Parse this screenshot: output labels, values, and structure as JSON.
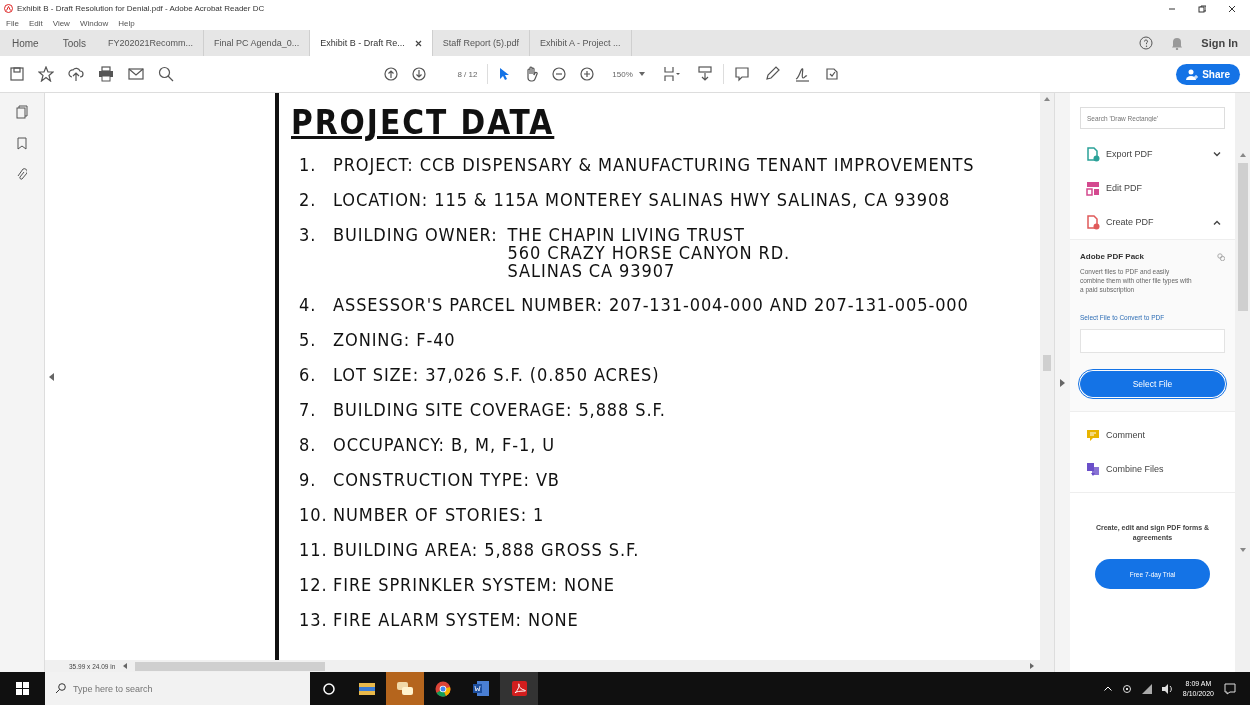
{
  "window": {
    "title": "Exhibit B - Draft Resolution for Denial.pdf - Adobe Acrobat Reader DC"
  },
  "menu": [
    "File",
    "Edit",
    "View",
    "Window",
    "Help"
  ],
  "tabs": [
    {
      "label": "Home",
      "selected": false,
      "closable": false
    },
    {
      "label": "Tools",
      "selected": false,
      "closable": false
    },
    {
      "label": "FY202021Recomm...",
      "selected": false,
      "closable": false
    },
    {
      "label": "Final PC Agenda_0...",
      "selected": false,
      "closable": false
    },
    {
      "label": "Exhibit B - Draft Re...",
      "selected": true,
      "closable": true
    },
    {
      "label": "Staff Report (5).pdf",
      "selected": false,
      "closable": false
    },
    {
      "label": "Exhibit A - Project ...",
      "selected": false,
      "closable": false
    }
  ],
  "account": {
    "sign_in": "Sign In"
  },
  "toolbar": {
    "page_number": "8",
    "page_count": "/ 12",
    "zoom": "150%",
    "share": "Share"
  },
  "document": {
    "heading": "PROJECT DATA",
    "items": [
      {
        "number": "1.",
        "text": "PROJECT:  CCB DISPENSARY & MANUFACTURING TENANT IMPROVEMENTS"
      },
      {
        "number": "2.",
        "text": "LOCATION: 115 & 115A MONTEREY SALINAS HWY SALINAS, CA 93908"
      },
      {
        "number": "3.",
        "label": "BUILDING OWNER:",
        "lines": [
          "THE CHAPIN LIVING TRUST",
          "560 CRAZY HORSE CANYON RD.",
          "SALINAS CA 93907"
        ]
      },
      {
        "number": "4.",
        "text": "ASSESSOR'S PARCEL NUMBER: 207-131-004-000 AND 207-131-005-000"
      },
      {
        "number": "5.",
        "text": "ZONING: F-40"
      },
      {
        "number": "6.",
        "text": "LOT SIZE: 37,026 S.F. (0.850 ACRES)"
      },
      {
        "number": "7.",
        "text": "BUILDING SITE COVERAGE: 5,888 S.F."
      },
      {
        "number": "8.",
        "text": "OCCUPANCY:  B, M, F-1, U"
      },
      {
        "number": "9.",
        "text": "CONSTRUCTION TYPE: VB"
      },
      {
        "number": "10.",
        "text": "NUMBER OF STORIES: 1"
      },
      {
        "number": "11.",
        "text": "BUILDING AREA:  5,888 GROSS S.F."
      },
      {
        "number": "12.",
        "text": "FIRE SPRINKLER SYSTEM: NONE"
      },
      {
        "number": "13.",
        "text": "FIRE ALARM SYSTEM: NONE"
      }
    ]
  },
  "page_size": "35.99 x 24.09 in",
  "tools_pane": {
    "search_placeholder": "Search 'Draw Rectangle'",
    "tools": [
      {
        "label": "Export PDF",
        "color": "#2aa198",
        "kind": "expandable",
        "expanded": false
      },
      {
        "label": "Edit PDF",
        "color": "#d4498f",
        "kind": "plain"
      },
      {
        "label": "Create PDF",
        "color": "#e05a5a",
        "kind": "expandable",
        "expanded": true
      }
    ],
    "pack": {
      "title": "Adobe PDF Pack",
      "description": "Convert files to PDF and easily combine them with other file types with a paid subscription",
      "link": "Select File to Convert to PDF",
      "button": "Select File"
    },
    "more_tools": [
      {
        "label": "Comment",
        "color": "#e8b400"
      },
      {
        "label": "Combine Files",
        "color": "#6a4fc9"
      }
    ],
    "promo": {
      "text": "Create, edit and sign PDF forms & agreements",
      "button": "Free 7-day Trial"
    }
  },
  "taskbar": {
    "search_placeholder": "Type here to search",
    "time": "8:09 AM",
    "date": "8/10/2020"
  }
}
